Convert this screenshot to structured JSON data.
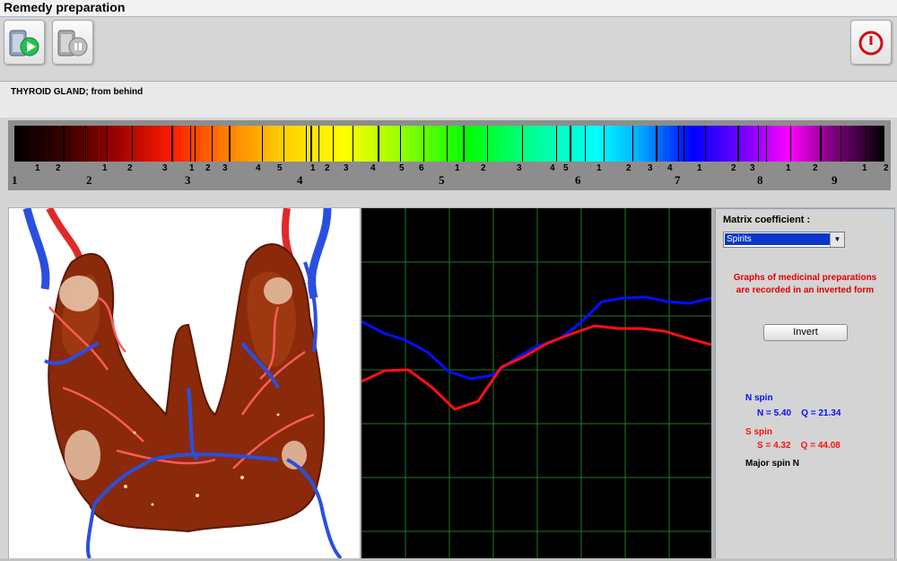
{
  "window": {
    "title": "Remedy preparation"
  },
  "toolbar": {
    "start_icon": "start-record-icon",
    "stop_icon": "stop-record-icon",
    "power_icon": "power-icon"
  },
  "subheader": {
    "text": "THYROID GLAND; from behind"
  },
  "spectrum": {
    "small_labels": [
      "1",
      "2",
      "1",
      "2",
      "3",
      "1",
      "2",
      "3",
      "4",
      "5",
      "1",
      "2",
      "3",
      "4",
      "5",
      "6",
      "1",
      "2",
      "3",
      "4",
      "5",
      "1",
      "2",
      "3",
      "4",
      "1",
      "2",
      "3",
      "1",
      "2",
      "1",
      "2"
    ],
    "big_labels": [
      "1",
      "2",
      "3",
      "4",
      "5",
      "6",
      "7",
      "8",
      "9"
    ]
  },
  "side": {
    "matrix_label": "Matrix coefficient :",
    "combo_value": "Spirits",
    "warning_line1": "Graphs of medicinal preparations",
    "warning_line2": "are recorded in an inverted form",
    "invert_label": "Invert",
    "n_spin_title": "N spin",
    "n_spin_values": "N = 5.40    Q = 21.34",
    "s_spin_title": "S spin",
    "s_spin_values": "S = 4.32    Q = 44.08",
    "major_spin": "Major spin N"
  },
  "colors": {
    "n_spin": "#0010ff",
    "s_spin": "#ff1010",
    "warning": "#e00000",
    "grid": "#1f7a2a"
  },
  "graph": {
    "blue_curve": [
      126,
      139,
      147,
      160,
      182,
      190,
      186,
      168,
      154,
      146,
      128,
      104,
      100,
      99,
      104,
      106,
      100
    ],
    "red_curve": [
      193,
      181,
      180,
      199,
      224,
      215,
      177,
      165,
      150,
      140,
      131,
      134,
      134,
      137,
      145,
      152
    ]
  }
}
